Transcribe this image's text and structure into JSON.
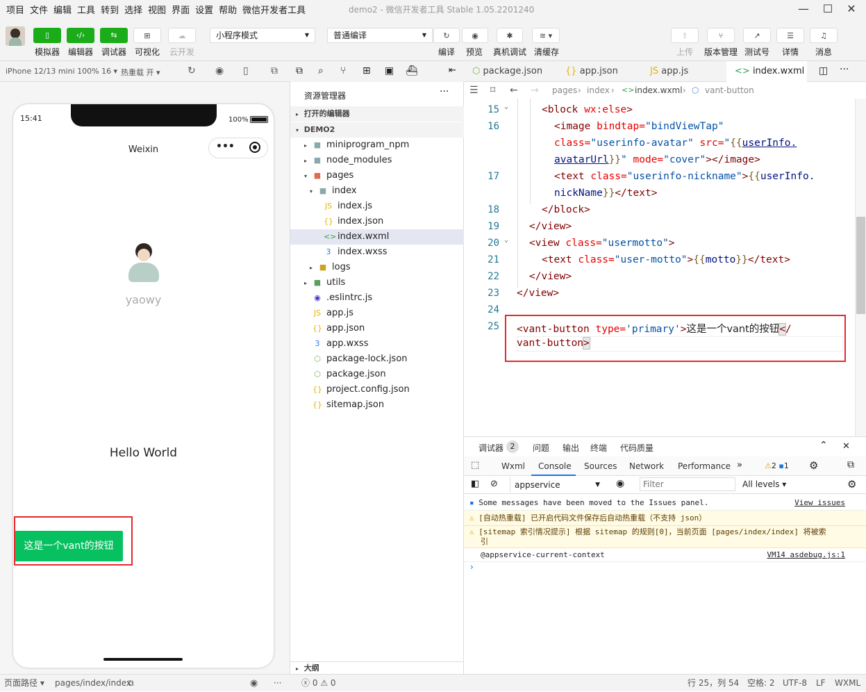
{
  "menubar": {
    "items": [
      "项目",
      "文件",
      "编辑",
      "工具",
      "转到",
      "选择",
      "视图",
      "界面",
      "设置",
      "帮助",
      "微信开发者工具"
    ],
    "window_title": "demo2 - 微信开发者工具 Stable 1.05.2201240"
  },
  "toolbar": {
    "left": [
      {
        "label": "模拟器"
      },
      {
        "label": "编辑器"
      },
      {
        "label": "调试器"
      },
      {
        "label": "可视化"
      },
      {
        "label": "云开发"
      }
    ],
    "mode_select": "小程序模式",
    "compile_select": "普通编译",
    "actions": [
      {
        "label": "编译"
      },
      {
        "label": "预览"
      },
      {
        "label": "真机调试"
      },
      {
        "label": "清缓存"
      }
    ],
    "right": [
      {
        "label": "上传"
      },
      {
        "label": "版本管理"
      },
      {
        "label": "测试号"
      },
      {
        "label": "详情"
      },
      {
        "label": "消息"
      }
    ]
  },
  "subbar": {
    "device": "iPhone 12/13 mini 100% 16",
    "hot_reload": "热重载 开"
  },
  "phone": {
    "time": "15:41",
    "battery": "100%",
    "nav_title": "Weixin",
    "nickname": "yaowy",
    "motto": "Hello World",
    "vant_button": "这是一个vant的按钮"
  },
  "explorer": {
    "title": "资源管理器",
    "open_editors": "打开的编辑器",
    "project": "DEMO2",
    "items": [
      {
        "name": "miniprogram_npm"
      },
      {
        "name": "node_modules"
      },
      {
        "name": "pages"
      },
      {
        "name": "index"
      },
      {
        "name": "index.js"
      },
      {
        "name": "index.json"
      },
      {
        "name": "index.wxml"
      },
      {
        "name": "index.wxss"
      },
      {
        "name": "logs"
      },
      {
        "name": "utils"
      },
      {
        "name": ".eslintrc.js"
      },
      {
        "name": "app.js"
      },
      {
        "name": "app.json"
      },
      {
        "name": "app.wxss"
      },
      {
        "name": "package-lock.json"
      },
      {
        "name": "package.json"
      },
      {
        "name": "project.config.json"
      },
      {
        "name": "sitemap.json"
      }
    ],
    "outline": "大纲"
  },
  "tabs": [
    {
      "label": "package.json"
    },
    {
      "label": "app.json"
    },
    {
      "label": "app.js"
    },
    {
      "label": "index.wxml"
    }
  ],
  "breadcrumb": {
    "parts": [
      "pages",
      "index",
      "index.wxml",
      "vant-button"
    ]
  },
  "editor": {
    "line_numbers": [
      "15",
      "16",
      "17",
      "18",
      "19",
      "20",
      "21",
      "22",
      "23",
      "24",
      "25"
    ],
    "code": {
      "l15_tag_open": "<block",
      "l15_attr": " wx:else",
      "l15_close": ">",
      "l16_tag": "<image",
      "l16_attr": " bindtap=",
      "l16_str": "\"bindViewTap\"",
      "l16b_attr": "class=",
      "l16b_str": "\"userinfo-avatar\"",
      "l16b_attr2": " src=",
      "l16b_q": "\"",
      "l16b_brace": "{{",
      "l16b_var": "userInfo.",
      "l16c_var": "avatarUrl",
      "l16c_brace": "}}",
      "l16c_q": "\"",
      "l16c_attr": " mode=",
      "l16c_str": "\"cover\"",
      "l16c_close": "></image>",
      "l17_tag": "<text",
      "l17_attr": " class=",
      "l17_str": "\"userinfo-nickname\"",
      "l17_gt": ">",
      "l17_brace": "{{",
      "l17_var": "userInfo.",
      "l17b_var": "nickName",
      "l17b_brace": "}}",
      "l17b_close": "</text>",
      "l18": "</block>",
      "l19": "</view>",
      "l20_tag": "<view",
      "l20_attr": " class=",
      "l20_str": "\"usermotto\"",
      "l20_gt": ">",
      "l21_tag": "<text",
      "l21_attr": " class=",
      "l21_str": "\"user-motto\"",
      "l21_gt": ">",
      "l21_b1": "{{",
      "l21_var": "motto",
      "l21_b2": "}}",
      "l21_close": "</text>",
      "l22": "</view>",
      "l23": "</view>",
      "l25_tag": "<vant-button",
      "l25_attr": " type=",
      "l25_str": "'primary'",
      "l25_gt": ">",
      "l25_text": "这是一个vant的按钮",
      "l25_lt": "<",
      "l25_slash": "/",
      "l25b_tag": "vant-button",
      "l25b_gt": ">"
    }
  },
  "debug": {
    "top_tabs": [
      {
        "label": "调试器"
      },
      {
        "label": "问题"
      },
      {
        "label": "输出"
      },
      {
        "label": "终端"
      },
      {
        "label": "代码质量"
      }
    ],
    "badge": "2",
    "devtools_tabs": [
      {
        "label": "Wxml"
      },
      {
        "label": "Console"
      },
      {
        "label": "Sources"
      },
      {
        "label": "Network"
      },
      {
        "label": "Performance"
      }
    ],
    "warn_count": "2",
    "info_count": "1",
    "context": "appservice",
    "filter_placeholder": "Filter",
    "levels": "All levels",
    "messages": {
      "m1": "Some messages have been moved to the Issues panel.",
      "m1_link": "View issues",
      "m2": "[自动热重载] 已开启代码文件保存后自动热重载（不支持 json）",
      "m3a": "[sitemap 索引情况提示] 根据 sitemap 的规则[0]，当前页面 [pages/index/index] 将被索",
      "m3b": "引",
      "m4": "@appservice-current-context",
      "m4_link": "VM14 asdebug.js:1"
    }
  },
  "statusbar": {
    "path_label": "页面路径",
    "path": "pages/index/index",
    "errors": "0",
    "warnings": "0",
    "position": "行 25，列 54",
    "spaces": "空格: 2",
    "encoding": "UTF-8",
    "eol": "LF",
    "lang": "WXML"
  }
}
